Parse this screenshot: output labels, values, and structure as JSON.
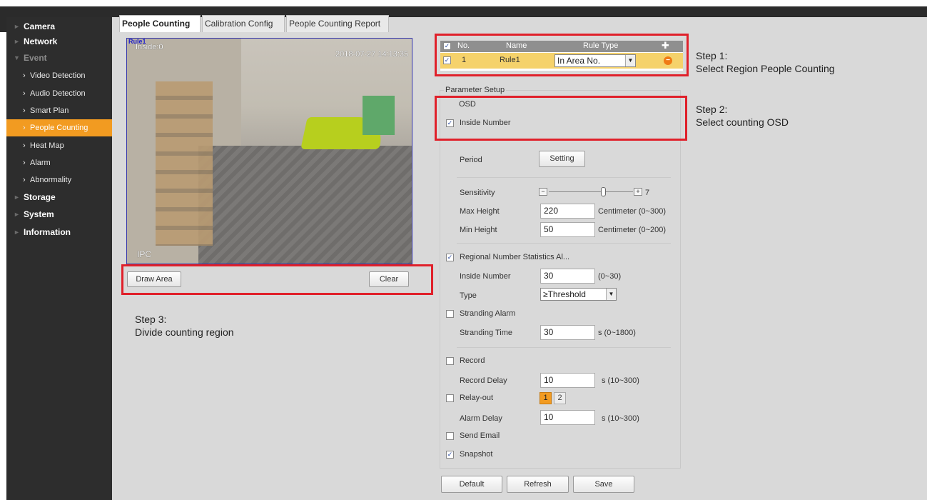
{
  "sidebar": {
    "items": [
      {
        "label": "Camera",
        "kind": "top",
        "expanded": false
      },
      {
        "label": "Network",
        "kind": "top",
        "expanded": false
      },
      {
        "label": "Event",
        "kind": "top",
        "expanded": true
      },
      {
        "label": "Video Detection",
        "kind": "sub"
      },
      {
        "label": "Audio Detection",
        "kind": "sub"
      },
      {
        "label": "Smart Plan",
        "kind": "sub"
      },
      {
        "label": "People Counting",
        "kind": "sub",
        "active": true
      },
      {
        "label": "Heat Map",
        "kind": "sub"
      },
      {
        "label": "Alarm",
        "kind": "sub"
      },
      {
        "label": "Abnormality",
        "kind": "sub"
      },
      {
        "label": "Storage",
        "kind": "top",
        "expanded": false
      },
      {
        "label": "System",
        "kind": "top",
        "expanded": false
      },
      {
        "label": "Information",
        "kind": "top",
        "expanded": false
      }
    ]
  },
  "tabs": [
    {
      "label": "People Counting",
      "active": true
    },
    {
      "label": "Calibration Config",
      "active": false
    },
    {
      "label": "People Counting Report",
      "active": false
    }
  ],
  "video": {
    "osd_inside": "Inside:0",
    "timestamp": "2018-07-27 14:13:35",
    "channel": "IPC",
    "rule_tag": "Rule1"
  },
  "video_buttons": {
    "draw_area": "Draw Area",
    "clear": "Clear"
  },
  "steps": {
    "step1": "Step 1:\nSelect Region People Counting",
    "step2": "Step 2:\nSelect counting OSD",
    "step3": "Step 3:\nDivide counting region"
  },
  "rule_table": {
    "headers": {
      "no": "No.",
      "name": "Name",
      "rule_type": "Rule Type"
    },
    "rows": [
      {
        "no": "1",
        "name": "Rule1",
        "rule_type": "In Area No.",
        "checked": true
      }
    ]
  },
  "params": {
    "legend": "Parameter Setup",
    "osd_label": "OSD",
    "inside_number_osd": "Inside Number",
    "period_label": "Period",
    "setting_button": "Setting",
    "sensitivity_label": "Sensitivity",
    "sensitivity_value": "7",
    "max_height_label": "Max Height",
    "max_height_value": "220",
    "max_height_unit": "Centimeter (0~300)",
    "min_height_label": "Min Height",
    "min_height_value": "50",
    "min_height_unit": "Centimeter (0~200)",
    "regional_label": "Regional Number Statistics Al...",
    "inside_number_label": "Inside Number",
    "inside_number_value": "30",
    "inside_number_range": "(0~30)",
    "type_label": "Type",
    "type_value": "≥Threshold",
    "stranding_alarm_label": "Stranding Alarm",
    "stranding_time_label": "Stranding Time",
    "stranding_time_value": "30",
    "stranding_time_unit": "s (0~1800)",
    "record_label": "Record",
    "record_delay_label": "Record Delay",
    "record_delay_value": "10",
    "record_delay_unit": "s (10~300)",
    "relay_out_label": "Relay-out",
    "relay_1": "1",
    "relay_2": "2",
    "alarm_delay_label": "Alarm Delay",
    "alarm_delay_value": "10",
    "alarm_delay_unit": "s (10~300)",
    "send_email_label": "Send Email",
    "snapshot_label": "Snapshot"
  },
  "footer_buttons": {
    "default": "Default",
    "refresh": "Refresh",
    "save": "Save"
  },
  "colors": {
    "accent": "#f29b21",
    "highlight": "#e0202a",
    "sidebar_bg": "#2d2d2d",
    "row_selected": "#f5d26b"
  }
}
